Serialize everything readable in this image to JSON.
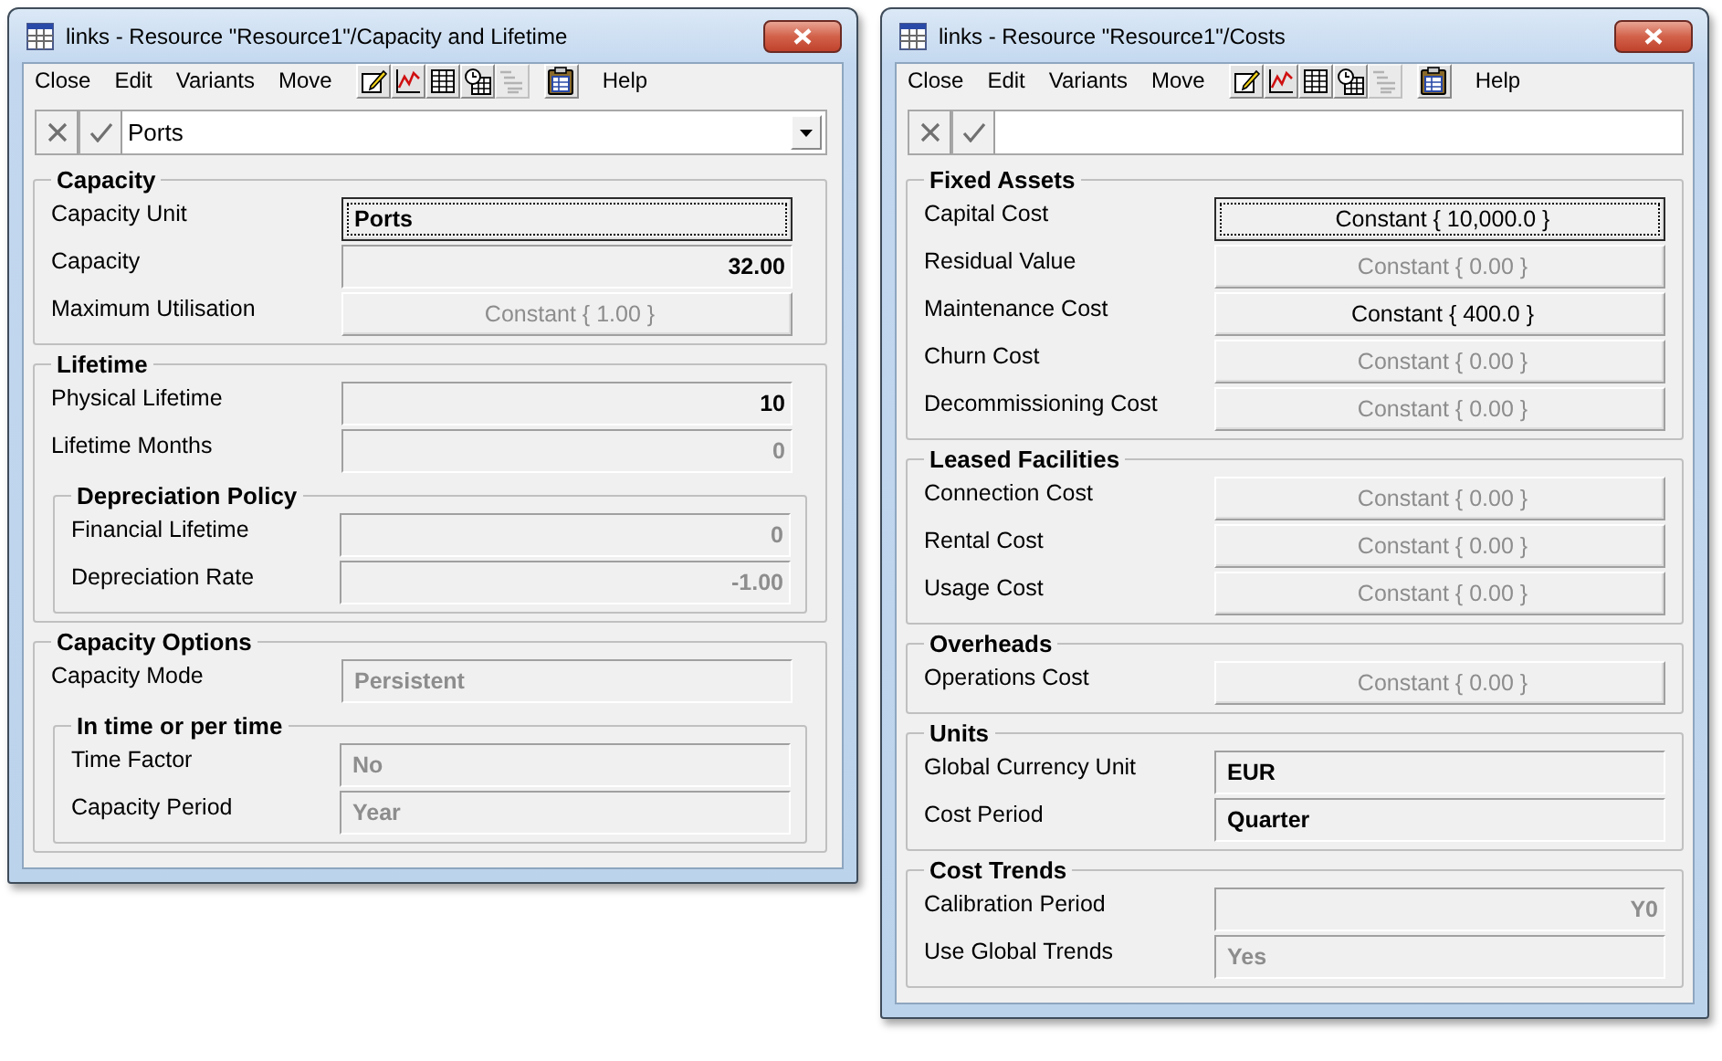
{
  "windows": [
    {
      "title": "links - Resource \"Resource1\"/Capacity and Lifetime",
      "menu": [
        {
          "kind": "menu",
          "label": "Close"
        },
        {
          "kind": "menu",
          "label": "Edit"
        },
        {
          "kind": "menu",
          "label": "Variants"
        },
        {
          "kind": "menu",
          "label": "Move"
        },
        {
          "kind": "tool",
          "disabled": false
        },
        {
          "kind": "tool",
          "disabled": false
        },
        {
          "kind": "tool",
          "disabled": false
        },
        {
          "kind": "tool",
          "disabled": false
        },
        {
          "kind": "tool",
          "disabled": true
        },
        {
          "kind": "tool",
          "disabled": false
        },
        {
          "kind": "menu",
          "label": "Help"
        }
      ],
      "entry": {
        "value": "Ports",
        "dropdown": true
      },
      "groups": [
        {
          "title": "Capacity",
          "rows": [
            {
              "label": "Capacity Unit",
              "field": {
                "kind": "choice",
                "value": "Ports",
                "disabled": false,
                "focused": true
              }
            },
            {
              "label": "Capacity",
              "field": {
                "kind": "number",
                "value": "32.00",
                "disabled": false,
                "focused": false
              }
            },
            {
              "label": "Maximum Utilisation",
              "field": {
                "kind": "button",
                "value": "Constant { 1.00 }",
                "disabled": true,
                "focused": false
              }
            }
          ]
        },
        {
          "title": "Lifetime",
          "rows": [
            {
              "label": "Physical Lifetime",
              "field": {
                "kind": "number",
                "value": "10",
                "disabled": false,
                "focused": false
              }
            },
            {
              "label": "Lifetime Months",
              "field": {
                "kind": "number",
                "value": "0",
                "disabled": true,
                "focused": false
              }
            }
          ],
          "groups": [
            {
              "title": "Depreciation Policy",
              "rows": [
                {
                  "label": "Financial Lifetime",
                  "field": {
                    "kind": "number",
                    "value": "0",
                    "disabled": true,
                    "focused": false
                  }
                },
                {
                  "label": "Depreciation Rate",
                  "field": {
                    "kind": "number",
                    "value": "-1.00",
                    "disabled": true,
                    "focused": false
                  }
                }
              ]
            }
          ]
        },
        {
          "title": "Capacity Options",
          "rows": [
            {
              "label": "Capacity Mode",
              "field": {
                "kind": "text",
                "value": "Persistent",
                "disabled": true,
                "focused": false
              }
            }
          ],
          "groups": [
            {
              "title": "In time or per time",
              "rows": [
                {
                  "label": "Time Factor",
                  "field": {
                    "kind": "text",
                    "value": "No",
                    "disabled": true,
                    "focused": false
                  }
                },
                {
                  "label": "Capacity Period",
                  "field": {
                    "kind": "text",
                    "value": "Year",
                    "disabled": true,
                    "focused": false
                  }
                }
              ]
            }
          ]
        }
      ]
    },
    {
      "title": "links - Resource \"Resource1\"/Costs",
      "menu": [
        {
          "kind": "menu",
          "label": "Close"
        },
        {
          "kind": "menu",
          "label": "Edit"
        },
        {
          "kind": "menu",
          "label": "Variants"
        },
        {
          "kind": "menu",
          "label": "Move"
        },
        {
          "kind": "tool",
          "disabled": false
        },
        {
          "kind": "tool",
          "disabled": false
        },
        {
          "kind": "tool",
          "disabled": false
        },
        {
          "kind": "tool",
          "disabled": false
        },
        {
          "kind": "tool",
          "disabled": true
        },
        {
          "kind": "tool",
          "disabled": false
        },
        {
          "kind": "menu",
          "label": "Help"
        }
      ],
      "entry": {
        "dropdown": false
      },
      "groups": [
        {
          "title": "Fixed Assets",
          "rows": [
            {
              "label": "Capital Cost",
              "field": {
                "kind": "button",
                "value": "Constant { 10,000.0 }",
                "disabled": false,
                "focused": true
              }
            },
            {
              "label": "Residual Value",
              "field": {
                "kind": "button",
                "value": "Constant { 0.00 }",
                "disabled": true,
                "focused": false
              }
            },
            {
              "label": "Maintenance Cost",
              "field": {
                "kind": "button",
                "value": "Constant { 400.0 }",
                "disabled": false,
                "focused": false
              }
            },
            {
              "label": "Churn Cost",
              "field": {
                "kind": "button",
                "value": "Constant { 0.00 }",
                "disabled": true,
                "focused": false
              }
            },
            {
              "label": "Decommissioning Cost",
              "field": {
                "kind": "button",
                "value": "Constant { 0.00 }",
                "disabled": true,
                "focused": false
              }
            }
          ]
        },
        {
          "title": "Leased Facilities",
          "rows": [
            {
              "label": "Connection Cost",
              "field": {
                "kind": "button",
                "value": "Constant { 0.00 }",
                "disabled": true,
                "focused": false
              }
            },
            {
              "label": "Rental Cost",
              "field": {
                "kind": "button",
                "value": "Constant { 0.00 }",
                "disabled": true,
                "focused": false
              }
            },
            {
              "label": "Usage Cost",
              "field": {
                "kind": "button",
                "value": "Constant { 0.00 }",
                "disabled": true,
                "focused": false
              }
            }
          ]
        },
        {
          "title": "Overheads",
          "rows": [
            {
              "label": "Operations Cost",
              "field": {
                "kind": "button",
                "value": "Constant { 0.00 }",
                "disabled": true,
                "focused": false
              }
            }
          ]
        },
        {
          "title": "Units",
          "rows": [
            {
              "label": "Global Currency Unit",
              "field": {
                "kind": "text",
                "value": "EUR",
                "disabled": false,
                "focused": false
              }
            },
            {
              "label": "Cost Period",
              "field": {
                "kind": "text",
                "value": "Quarter",
                "disabled": false,
                "focused": false
              }
            }
          ]
        },
        {
          "title": "Cost Trends",
          "rows": [
            {
              "label": "Calibration Period",
              "field": {
                "kind": "number",
                "value": "Y0",
                "disabled": true,
                "focused": false
              }
            },
            {
              "label": "Use Global Trends",
              "field": {
                "kind": "text",
                "value": "Yes",
                "disabled": true,
                "focused": false
              }
            }
          ]
        }
      ]
    }
  ]
}
